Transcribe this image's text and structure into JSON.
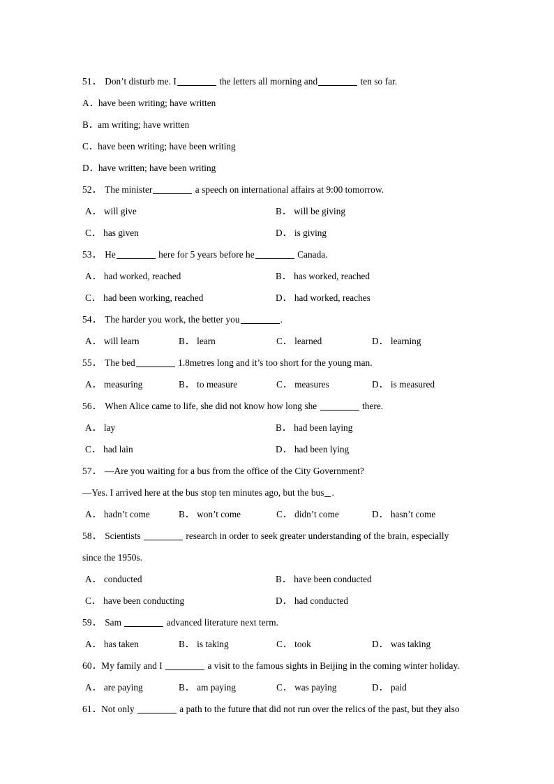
{
  "document": {
    "type": "english-grammar-multiple-choice-worksheet",
    "page_background": "#ffffff",
    "text_color": "#000000"
  },
  "questions": [
    {
      "number": "51．",
      "number_spacing": "wide",
      "stem_parts": [
        {
          "kind": "text",
          "text": "Don’t disturb me. I"
        },
        {
          "kind": "blank",
          "size": "md"
        },
        {
          "kind": "text",
          "text": " the letters all morning and"
        },
        {
          "kind": "blank",
          "size": "md"
        },
        {
          "kind": "text",
          "text": " ten so far."
        }
      ],
      "layout": "stacked",
      "options": [
        {
          "mark": "A．",
          "text": "have been writing; have written"
        },
        {
          "mark": "B．",
          "text": "am writing; have written"
        },
        {
          "mark": "C．",
          "text": "have been writing; have been writing"
        },
        {
          "mark": "D．",
          "text": "have written; have been writing"
        }
      ]
    },
    {
      "number": "52．",
      "number_spacing": "wide",
      "stem_parts": [
        {
          "kind": "text",
          "text": "The minister"
        },
        {
          "kind": "blank",
          "size": "md"
        },
        {
          "kind": "text",
          "text": " a speech on international affairs at 9:00 tomorrow."
        }
      ],
      "layout": "cols2",
      "options": [
        {
          "mark": "A．",
          "text": "will give"
        },
        {
          "mark": "B．",
          "text": "will be giving"
        },
        {
          "mark": "C．",
          "text": "has given"
        },
        {
          "mark": "D．",
          "text": "is giving"
        }
      ]
    },
    {
      "number": "53．",
      "number_spacing": "wide",
      "stem_parts": [
        {
          "kind": "text",
          "text": "He"
        },
        {
          "kind": "blank",
          "size": "md"
        },
        {
          "kind": "text",
          "text": " here for 5 years before he"
        },
        {
          "kind": "blank",
          "size": "md"
        },
        {
          "kind": "text",
          "text": " Canada."
        }
      ],
      "layout": "cols2",
      "options": [
        {
          "mark": "A．",
          "text": "had worked, reached"
        },
        {
          "mark": "B．",
          "text": "has worked, reached"
        },
        {
          "mark": "C．",
          "text": "had been working, reached"
        },
        {
          "mark": "D．",
          "text": "had worked, reaches"
        }
      ]
    },
    {
      "number": "54．",
      "number_spacing": "wide",
      "stem_parts": [
        {
          "kind": "text",
          "text": "The harder you work, the better you"
        },
        {
          "kind": "blank",
          "size": "md"
        },
        {
          "kind": "text",
          "text": "."
        }
      ],
      "layout": "cols4",
      "options": [
        {
          "mark": "A．",
          "text": "will learn"
        },
        {
          "mark": "B．",
          "text": "learn"
        },
        {
          "mark": "C．",
          "text": "learned"
        },
        {
          "mark": "D．",
          "text": "learning"
        }
      ]
    },
    {
      "number": "55．",
      "number_spacing": "wide",
      "stem_parts": [
        {
          "kind": "text",
          "text": "The bed"
        },
        {
          "kind": "blank",
          "size": "md"
        },
        {
          "kind": "text",
          "text": " 1.8metres long and it’s too short for the young man."
        }
      ],
      "layout": "cols4",
      "options": [
        {
          "mark": "A．",
          "text": "measuring"
        },
        {
          "mark": "B．",
          "text": "to measure"
        },
        {
          "mark": "C．",
          "text": "measures"
        },
        {
          "mark": "D．",
          "text": "is measured"
        }
      ]
    },
    {
      "number": "56．",
      "number_spacing": "wide",
      "stem_parts": [
        {
          "kind": "text",
          "text": "When Alice came to life, she did not know how long she "
        },
        {
          "kind": "blank",
          "size": "md"
        },
        {
          "kind": "text",
          "text": " there."
        }
      ],
      "layout": "cols2",
      "options": [
        {
          "mark": "A．",
          "text": "lay"
        },
        {
          "mark": "B．",
          "text": "had been laying"
        },
        {
          "mark": "C．",
          "text": "had lain"
        },
        {
          "mark": "D．",
          "text": "had been lying"
        }
      ]
    },
    {
      "number": "57．",
      "number_spacing": "wide",
      "stem_parts": [
        {
          "kind": "text",
          "text": "—Are you waiting for a bus from the office of the City Government?"
        }
      ],
      "extra_lines": [
        [
          {
            "kind": "text",
            "text": "—Yes. I arrived here at the bus stop ten minutes ago, but the bus"
          },
          {
            "kind": "blank",
            "size": "xs"
          },
          {
            "kind": "text",
            "text": "."
          }
        ]
      ],
      "layout": "cols4",
      "options": [
        {
          "mark": "A．",
          "text": "hadn’t come"
        },
        {
          "mark": "B．",
          "text": "won’t come"
        },
        {
          "mark": "C．",
          "text": "didn’t come"
        },
        {
          "mark": "D．",
          "text": "hasn’t come"
        }
      ]
    },
    {
      "number": "58．",
      "number_spacing": "wide",
      "stem_parts": [
        {
          "kind": "text",
          "text": "Scientists "
        },
        {
          "kind": "blank",
          "size": "md"
        },
        {
          "kind": "text",
          "text": " research in order to seek greater understanding of the brain, especially"
        }
      ],
      "extra_lines": [
        [
          {
            "kind": "text",
            "text": "since the 1950s."
          }
        ]
      ],
      "layout": "cols2",
      "options": [
        {
          "mark": "A．",
          "text": "conducted"
        },
        {
          "mark": "B．",
          "text": "have been conducted"
        },
        {
          "mark": "C．",
          "text": "have been conducting"
        },
        {
          "mark": "D．",
          "text": "had conducted"
        }
      ]
    },
    {
      "number": "59．",
      "number_spacing": "wide",
      "stem_parts": [
        {
          "kind": "text",
          "text": "Sam "
        },
        {
          "kind": "blank",
          "size": "md"
        },
        {
          "kind": "text",
          "text": " advanced literature next term."
        }
      ],
      "layout": "cols4",
      "options": [
        {
          "mark": "A．",
          "text": "has taken"
        },
        {
          "mark": "B．",
          "text": "is taking"
        },
        {
          "mark": "C．",
          "text": "took"
        },
        {
          "mark": "D．",
          "text": "was taking"
        }
      ]
    },
    {
      "number": "60．",
      "number_spacing": "tight",
      "stem_parts": [
        {
          "kind": "text",
          "text": "My family and I "
        },
        {
          "kind": "blank",
          "size": "md"
        },
        {
          "kind": "text",
          "text": " a visit to the famous sights in Beijing in the coming winter holiday."
        }
      ],
      "layout": "cols4",
      "options": [
        {
          "mark": "A．",
          "text": "are paying"
        },
        {
          "mark": "B．",
          "text": "am paying"
        },
        {
          "mark": "C．",
          "text": "was paying"
        },
        {
          "mark": "D．",
          "text": "paid"
        }
      ]
    },
    {
      "number": "61．",
      "number_spacing": "tight",
      "stem_parts": [
        {
          "kind": "text",
          "text": "Not only "
        },
        {
          "kind": "blank",
          "size": "md"
        },
        {
          "kind": "text",
          "text": " a path to the future that did not run over the relics of the past, but they also"
        }
      ],
      "layout": "none",
      "options": []
    }
  ]
}
